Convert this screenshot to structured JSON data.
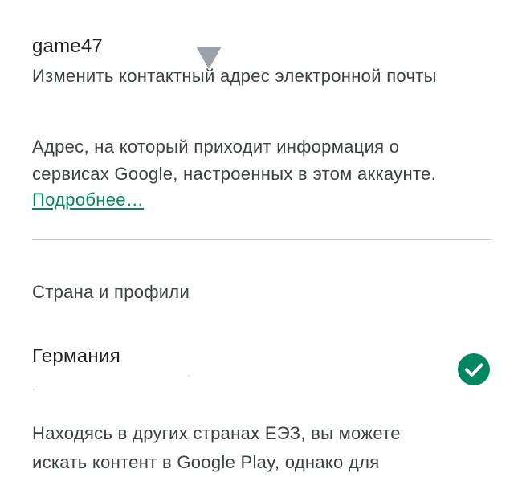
{
  "contact_email": {
    "value": "game47",
    "change_link_label": "Изменить контактный адрес электронной почты"
  },
  "description": {
    "lines": [
      "Адрес, на который приходит информация о",
      "сервисах Google, настроенных в этом аккаунте."
    ],
    "more_link": "Подробнее…"
  },
  "country_section": {
    "title": "Страна и профили",
    "country": "Германия",
    "selected_icon": "check-circle-icon",
    "note_lines": [
      "Находясь в других странах ЕЭЗ, вы можете",
      "искать контент в Google Play, однако для"
    ]
  },
  "colors": {
    "accent": "#01875f",
    "text_primary": "#202124",
    "text_secondary": "#3c4043",
    "divider": "#c4c7c5",
    "pointer": "#9aa0a6"
  }
}
